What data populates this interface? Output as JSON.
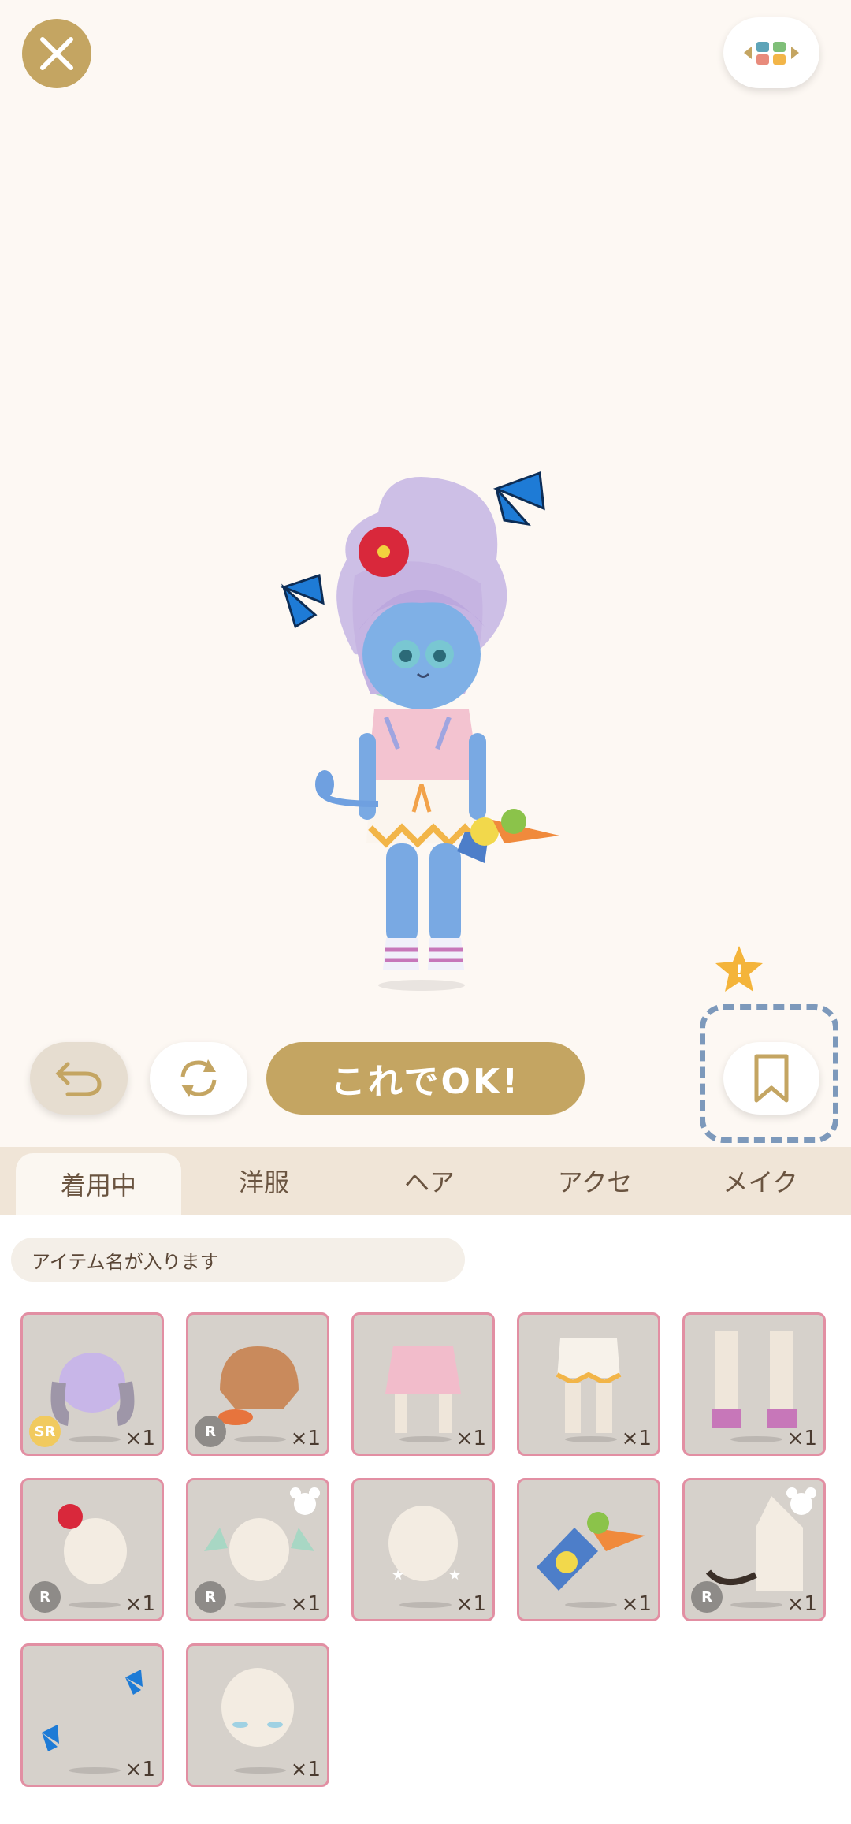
{
  "top": {
    "close_icon": "close-icon",
    "layout_icon": "arrows-grid-icon"
  },
  "actions": {
    "undo_icon": "undo-icon",
    "reroll_icon": "refresh-icon",
    "ok_label": "これでOK!",
    "bookmark_icon": "bookmark-icon",
    "notice_icon": "star-exclamation-icon",
    "notice_label": "!"
  },
  "tabs": [
    {
      "label": "着用中",
      "active": true
    },
    {
      "label": "洋服",
      "active": false
    },
    {
      "label": "ヘア",
      "active": false
    },
    {
      "label": "アクセ",
      "active": false
    },
    {
      "label": "メイク",
      "active": false
    }
  ],
  "item_name_placeholder": "アイテム名が入ります",
  "items": [
    {
      "name": "lavender-hair",
      "rarity": "SR",
      "count": "×1"
    },
    {
      "name": "brown-hair",
      "rarity": "R",
      "count": "×1"
    },
    {
      "name": "pastel-shirt",
      "rarity": "",
      "count": "×1"
    },
    {
      "name": "white-shorts",
      "rarity": "",
      "count": "×1"
    },
    {
      "name": "striped-shoes",
      "rarity": "",
      "count": "×1"
    },
    {
      "name": "hibiscus-clip",
      "rarity": "R",
      "count": "×1"
    },
    {
      "name": "green-ears",
      "rarity": "R",
      "count": "×1",
      "badge": "bear-icon"
    },
    {
      "name": "star-earrings",
      "rarity": "",
      "count": "×1"
    },
    {
      "name": "tropical-drink",
      "rarity": "",
      "count": "×1"
    },
    {
      "name": "devil-tail",
      "rarity": "R",
      "count": "×1",
      "badge": "bear-icon"
    },
    {
      "name": "butterflies",
      "rarity": "",
      "count": "×1"
    },
    {
      "name": "blue-blush",
      "rarity": "",
      "count": "×1"
    }
  ],
  "colors": {
    "gold": "#c4a562",
    "border": "#e28fa3",
    "dash": "#7d99bb"
  }
}
